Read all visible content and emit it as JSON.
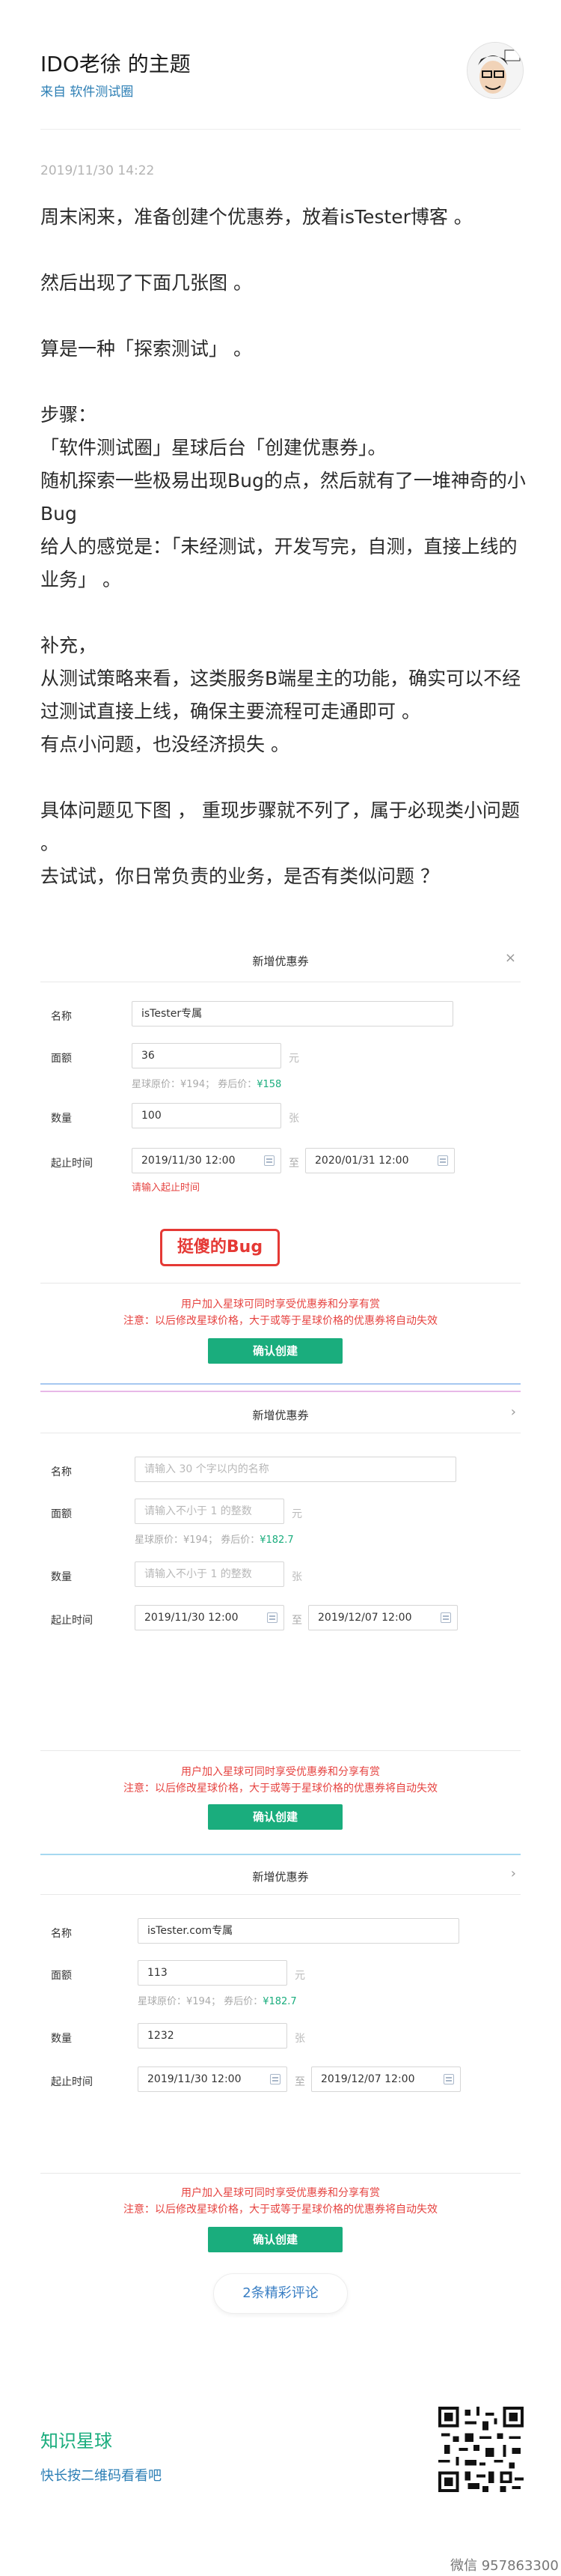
{
  "header": {
    "title": "IDO老徐 的主题",
    "source": "来自 软件测试圈"
  },
  "post": {
    "timestamp": "2019/11/30 14:22",
    "paragraphs": [
      "周末闲来，准备创建个优惠券，放着isTester博客 。",
      "然后出现了下面几张图 。",
      "算是一种「探索测试」 。",
      "步骤：\n「软件测试圈」星球后台「创建优惠券」。\n随机探索一些极易出现Bug的点，然后就有了一堆神奇的小Bug\n给人的感觉是：「未经测试，开发写完，自测，直接上线的业务」 。",
      "补充，\n从测试策略来看，这类服务B端星主的功能，确实可以不经过测试直接上线，确保主要流程可走通即可 。\n有点小问题，也没经济损失 。",
      "具体问题见下图 ， 重现步骤就不列了，属于必现类小问题 。\n去试试，你日常负责的业务，是否有类似问题 ？"
    ]
  },
  "panels": [
    {
      "title": "新增优惠券",
      "name_label": "名称",
      "name_value": "isTester专属",
      "amount_label": "面额",
      "amount_value": "36",
      "unit_yuan": "元",
      "price_prefix": "星球原价：¥194；  券后价：",
      "price_after": "¥158",
      "qty_label": "数量",
      "qty_value": "100",
      "unit_zhang": "张",
      "time_label": "起止时间",
      "start": "2019/11/30 12:00",
      "to": "至",
      "end": "2020/01/31 12:00",
      "error": "请输入起止时间",
      "bug_label": "挺傻的Bug",
      "note1": "用户加入星球可同时享受优惠券和分享有赏",
      "note2": "注意：以后修改星球价格，大于或等于星球价格的优惠券将自动失效",
      "confirm": "确认创建"
    },
    {
      "title": "新增优惠券",
      "name_label": "名称",
      "name_placeholder": "请输入 30 个字以内的名称",
      "amount_label": "面额",
      "amount_placeholder": "请输入不小于 1 的整数",
      "unit_yuan": "元",
      "price_prefix": "星球原价：¥194；  券后价：",
      "price_after": "¥182.7",
      "qty_label": "数量",
      "qty_placeholder": "请输入不小于 1 的整数",
      "unit_zhang": "张",
      "time_label": "起止时间",
      "start": "2019/11/30 12:00",
      "to": "至",
      "end": "2019/12/07 12:00",
      "note1": "用户加入星球可同时享受优惠券和分享有赏",
      "note2": "注意：以后修改星球价格，大于或等于星球价格的优惠券将自动失效",
      "confirm": "确认创建"
    },
    {
      "title": "新增优惠券",
      "name_label": "名称",
      "name_value": "isTester.com专属",
      "amount_label": "面额",
      "amount_value": "113",
      "unit_yuan": "元",
      "price_prefix": "星球原价：¥194；  券后价：",
      "price_after": "¥182.7",
      "qty_label": "数量",
      "qty_value": "1232",
      "unit_zhang": "张",
      "time_label": "起止时间",
      "start": "2019/11/30 12:00",
      "to": "至",
      "end": "2019/12/07 12:00",
      "note1": "用户加入星球可同时享受优惠券和分享有赏",
      "note2": "注意：以后修改星球价格，大于或等于星球价格的优惠券将自动失效",
      "confirm": "确认创建"
    }
  ],
  "comments": {
    "label": "2条精彩评论"
  },
  "footer": {
    "title": "知识星球",
    "subtitle": "快长按二维码看看吧",
    "wechat": "微信 957863300"
  },
  "colors": {
    "accent_green": "#1aad7d",
    "link_blue": "#2d7fb5",
    "error_red": "#e64340"
  },
  "icons": [
    "avatar-image",
    "close-icon",
    "calendar-icon",
    "chevron-right-icon",
    "qr-code"
  ]
}
